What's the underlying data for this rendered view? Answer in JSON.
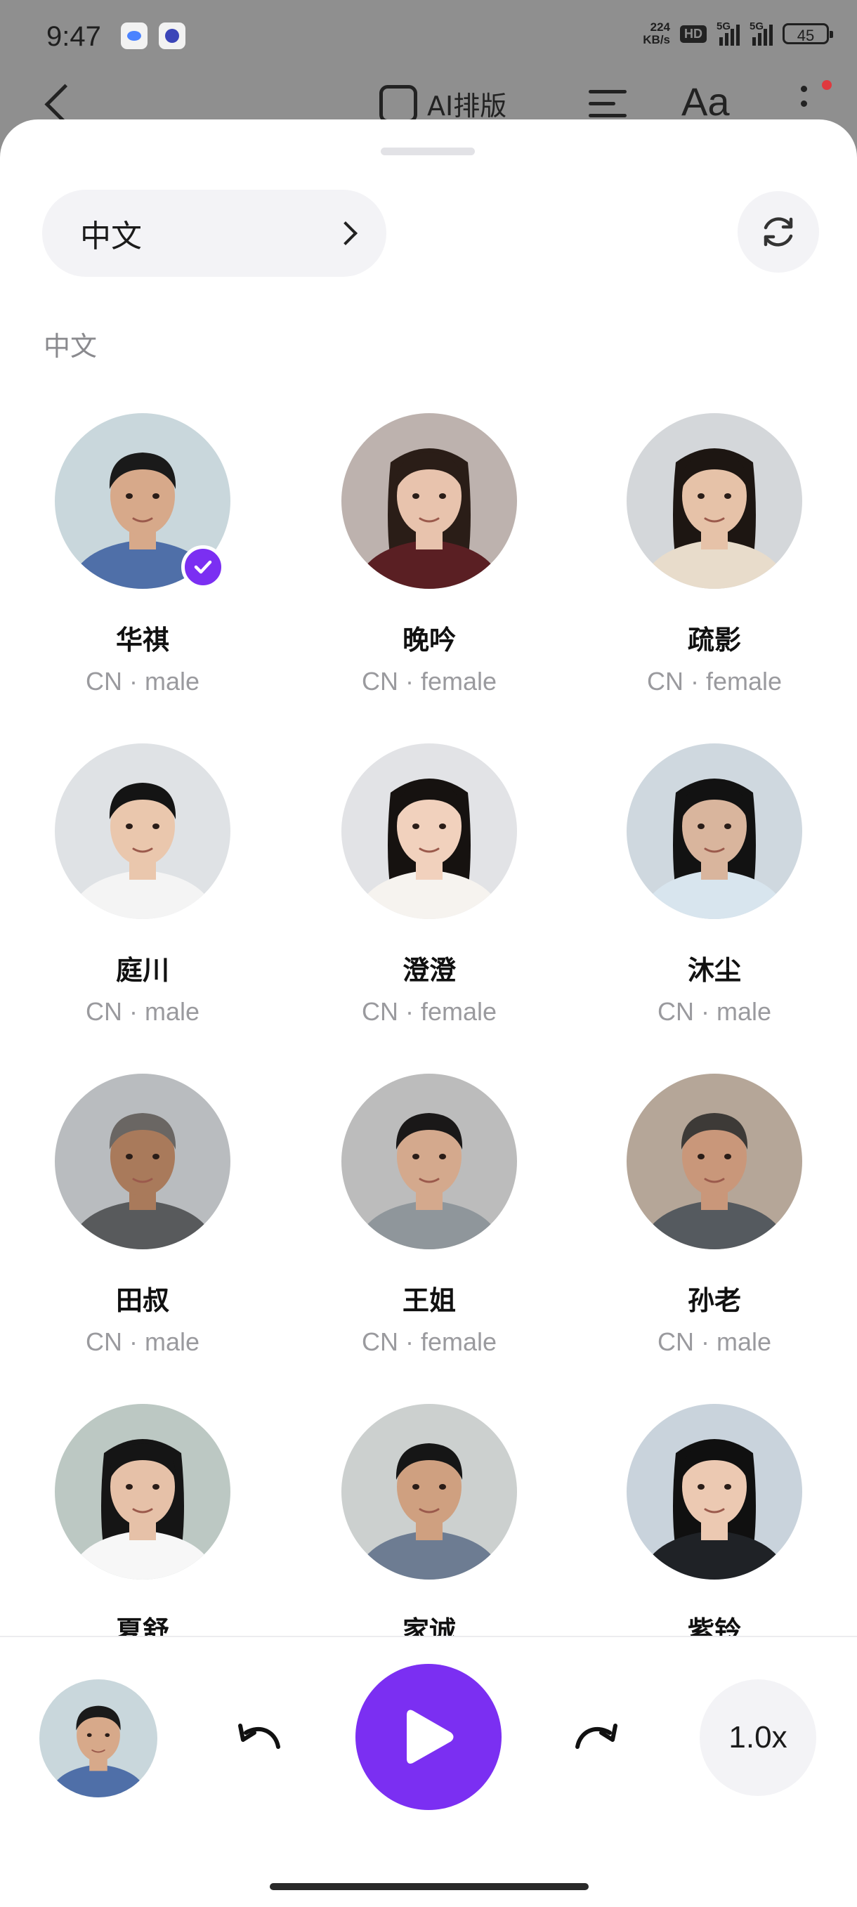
{
  "status_bar": {
    "time": "9:47",
    "net_speed_value": "224",
    "net_speed_unit": "KB/s",
    "hd_label": "HD",
    "signal1_label": "5G",
    "signal2_label": "5G",
    "battery": "45"
  },
  "toolbar": {
    "ai_layout_label": "AI排版",
    "font_label": "Aa"
  },
  "sheet": {
    "language_selector": "中文",
    "section_title": "中文",
    "voices": [
      {
        "name": "华祺",
        "region": "CN",
        "gender": "male",
        "selected": true
      },
      {
        "name": "晚吟",
        "region": "CN",
        "gender": "female",
        "selected": false
      },
      {
        "name": "疏影",
        "region": "CN",
        "gender": "female",
        "selected": false
      },
      {
        "name": "庭川",
        "region": "CN",
        "gender": "male",
        "selected": false
      },
      {
        "name": "澄澄",
        "region": "CN",
        "gender": "female",
        "selected": false
      },
      {
        "name": "沐尘",
        "region": "CN",
        "gender": "male",
        "selected": false
      },
      {
        "name": "田叔",
        "region": "CN",
        "gender": "male",
        "selected": false
      },
      {
        "name": "王姐",
        "region": "CN",
        "gender": "female",
        "selected": false
      },
      {
        "name": "孙老",
        "region": "CN",
        "gender": "male",
        "selected": false
      },
      {
        "name": "夏舒",
        "region": "",
        "gender": "",
        "selected": false
      },
      {
        "name": "家诚",
        "region": "",
        "gender": "",
        "selected": false
      },
      {
        "name": "紫铃",
        "region": "",
        "gender": "",
        "selected": false
      }
    ]
  },
  "player": {
    "speed_label": "1.0x"
  },
  "colors": {
    "accent": "#7b2ff2",
    "dim_overlay": "#8f8f8f"
  },
  "icons": {
    "back": "chevron-left-icon",
    "ai_layout": "sparkle-box-icon",
    "align": "align-left-icon",
    "more": "more-vertical-icon",
    "refresh": "refresh-icon",
    "selected": "check-icon",
    "rewind": "rewind-icon",
    "play": "play-icon",
    "forward": "forward-icon"
  }
}
